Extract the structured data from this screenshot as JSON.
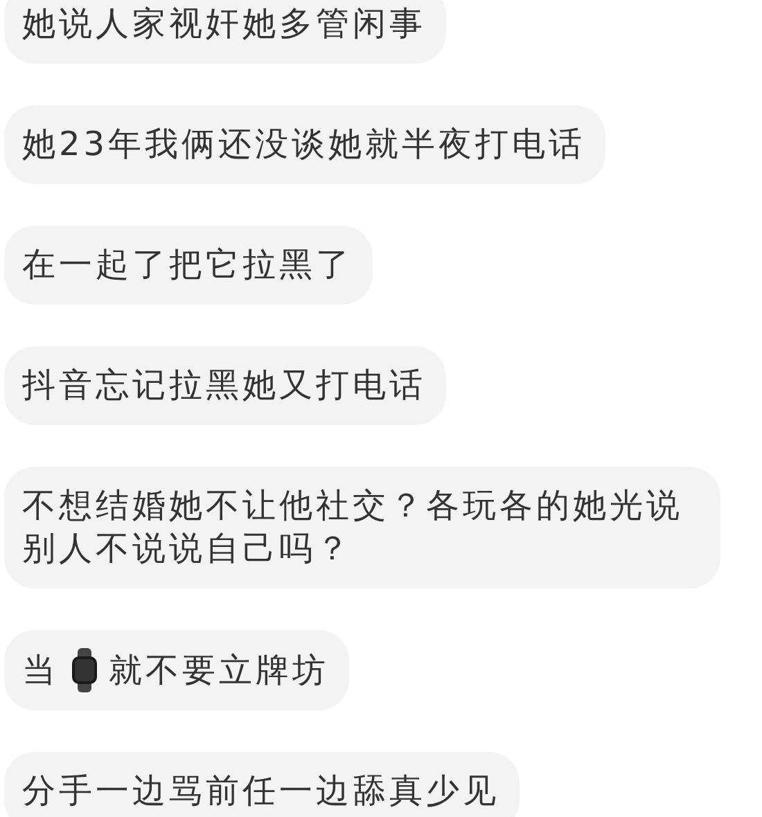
{
  "messages": [
    {
      "segments": [
        {
          "kind": "text",
          "text": "她说人家视奸她多管闲事"
        }
      ]
    },
    {
      "segments": [
        {
          "kind": "text",
          "text": "她23年我俩还没谈她就半夜打电话"
        }
      ]
    },
    {
      "segments": [
        {
          "kind": "text",
          "text": "在一起了把它拉黑了"
        }
      ]
    },
    {
      "segments": [
        {
          "kind": "text",
          "text": "抖音忘记拉黑她又打电话"
        }
      ]
    },
    {
      "segments": [
        {
          "kind": "text",
          "text": "不想结婚她不让他社交？各玩各的她光说别人不说说自己吗？"
        }
      ]
    },
    {
      "segments": [
        {
          "kind": "text",
          "text": "当"
        },
        {
          "kind": "watch"
        },
        {
          "kind": "text",
          "text": "就不要立牌坊"
        }
      ]
    },
    {
      "segments": [
        {
          "kind": "text",
          "text": "分手一边骂前任一边舔真少见"
        }
      ]
    }
  ]
}
